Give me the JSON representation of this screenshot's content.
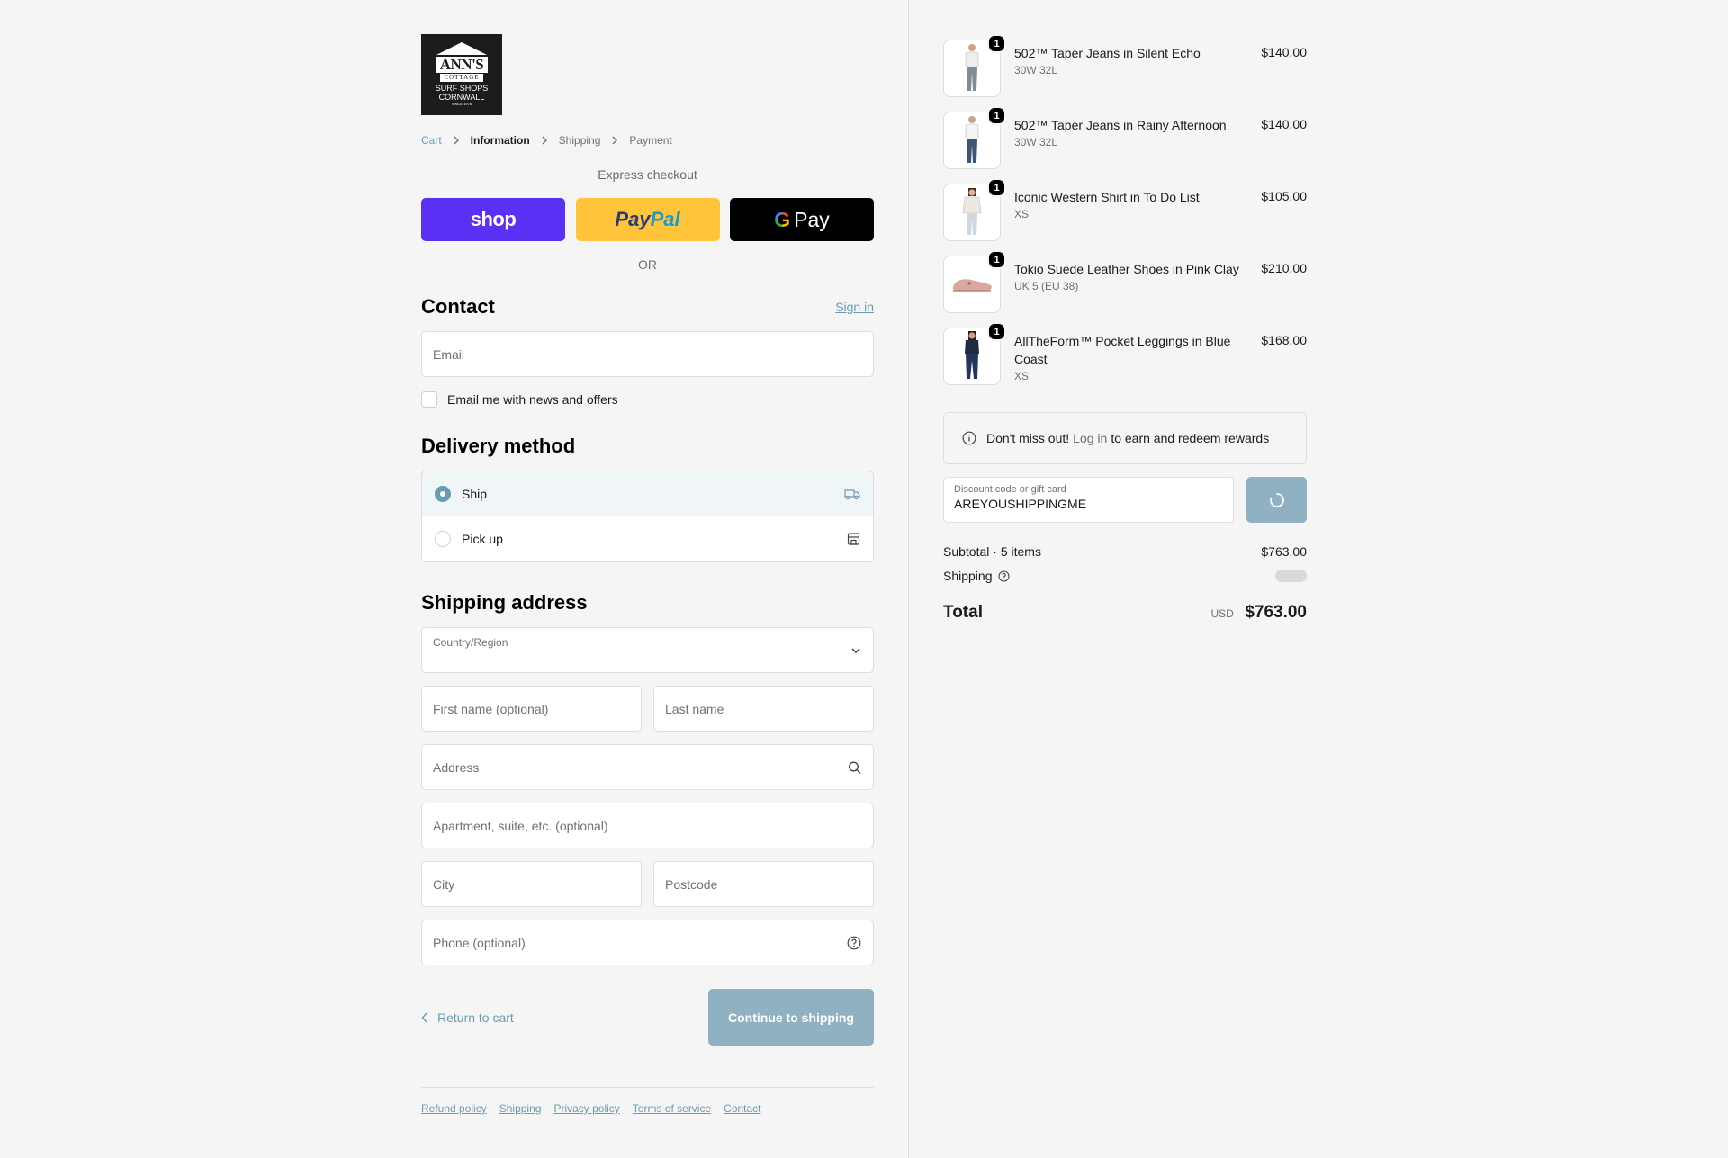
{
  "store": {
    "logo_name": "ANN'S",
    "logo_cottage": "COTTAGE",
    "logo_line1": "SURF SHOPS",
    "logo_line2": "CORNWALL",
    "logo_since": "SINCE 1978"
  },
  "breadcrumb": [
    "Cart",
    "Information",
    "Shipping",
    "Payment"
  ],
  "express": {
    "title": "Express checkout",
    "shop": "shop",
    "paypal_a": "Pay",
    "paypal_b": "Pal",
    "gpay_g": "G",
    "gpay_text": "Pay",
    "or": "OR"
  },
  "contact": {
    "title": "Contact",
    "sign_in": "Sign in",
    "email_placeholder": "Email",
    "news_label": "Email me with news and offers"
  },
  "delivery": {
    "title": "Delivery method",
    "options": [
      {
        "label": "Ship",
        "selected": true,
        "icon": "truck-icon"
      },
      {
        "label": "Pick up",
        "selected": false,
        "icon": "store-icon"
      }
    ]
  },
  "shipping": {
    "title": "Shipping address",
    "country_label": "Country/Region",
    "country_value": "",
    "first_name": "First name (optional)",
    "last_name": "Last name",
    "address": "Address",
    "apartment": "Apartment, suite, etc. (optional)",
    "city": "City",
    "postcode": "Postcode",
    "phone": "Phone (optional)"
  },
  "actions": {
    "return": "Return to cart",
    "continue": "Continue to shipping"
  },
  "footer": [
    "Refund policy",
    "Shipping",
    "Privacy policy",
    "Terms of service",
    "Contact"
  ],
  "cart": {
    "items": [
      {
        "name": "502™ Taper Jeans in Silent Echo",
        "variant": "30W 32L",
        "price": "$140.00",
        "qty": "1"
      },
      {
        "name": "502™ Taper Jeans in Rainy Afternoon",
        "variant": "30W 32L",
        "price": "$140.00",
        "qty": "1"
      },
      {
        "name": "Iconic Western Shirt in To Do List",
        "variant": "XS",
        "price": "$105.00",
        "qty": "1"
      },
      {
        "name": "Tokio Suede Leather Shoes in Pink Clay",
        "variant": "UK 5 (EU 38)",
        "price": "$210.00",
        "qty": "1"
      },
      {
        "name": "AllTheForm™ Pocket Leggings in Blue Coast",
        "variant": "XS",
        "price": "$168.00",
        "qty": "1"
      }
    ],
    "rewards_pre": "Don't miss out!",
    "rewards_link": "Log in",
    "rewards_post": "to earn and redeem rewards",
    "discount_label": "Discount code or gift card",
    "discount_value": "AREYOUSHIPPINGME",
    "subtotal_label": "Subtotal · 5 items",
    "subtotal_value": "$763.00",
    "shipping_label": "Shipping",
    "total_label": "Total",
    "total_currency": "USD",
    "total_value": "$763.00"
  },
  "colors": {
    "accent": "#6a9cb1",
    "button_disabled": "#8fb1c2",
    "shop_pay": "#5a31f4",
    "paypal": "#ffc439",
    "gpay": "#000000"
  }
}
